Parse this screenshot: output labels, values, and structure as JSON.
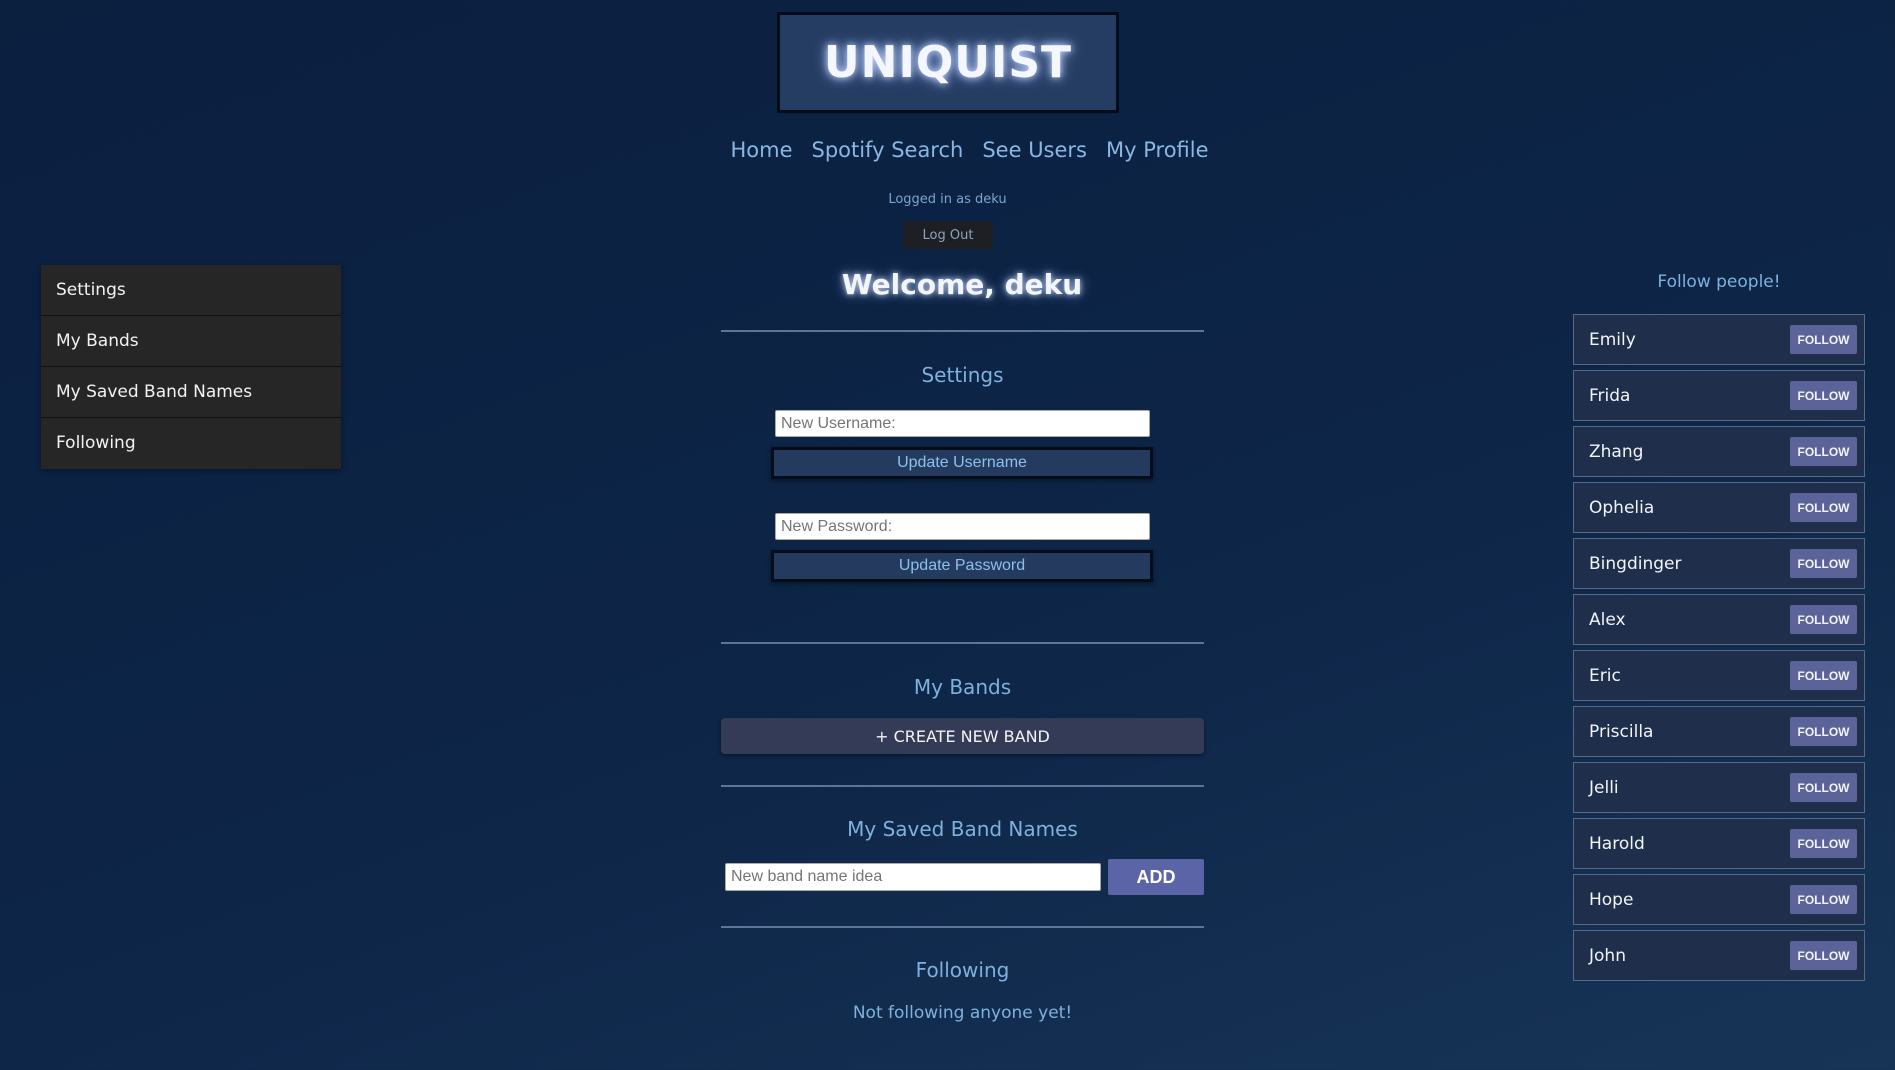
{
  "header": {
    "logo": "UNIQUIST",
    "nav": [
      "Home",
      "Spotify Search",
      "See Users",
      "My Profile"
    ],
    "logged_in_text": "Logged in as deku",
    "logout_label": "Log Out",
    "welcome": "Welcome, deku"
  },
  "sidebar": {
    "items": [
      {
        "label": "Settings"
      },
      {
        "label": "My Bands"
      },
      {
        "label": "My Saved Band Names"
      },
      {
        "label": "Following"
      }
    ]
  },
  "settings": {
    "title": "Settings",
    "username_placeholder": "New Username:",
    "update_username_label": "Update Username",
    "password_placeholder": "New Password:",
    "update_password_label": "Update Password"
  },
  "bands": {
    "title": "My Bands",
    "create_label": "+ CREATE NEW BAND"
  },
  "saved_names": {
    "title": "My Saved Band Names",
    "input_placeholder": "New band name idea",
    "add_label": "ADD"
  },
  "following": {
    "title": "Following",
    "empty_message": "Not following anyone yet!"
  },
  "follow_people": {
    "title": "Follow people!",
    "button_label": "FOLLOW",
    "users": [
      "Emily",
      "Frida",
      "Zhang",
      "Ophelia",
      "Bingdinger",
      "Alex",
      "Eric",
      "Priscilla",
      "Jelli",
      "Harold",
      "Hope",
      "John"
    ]
  }
}
